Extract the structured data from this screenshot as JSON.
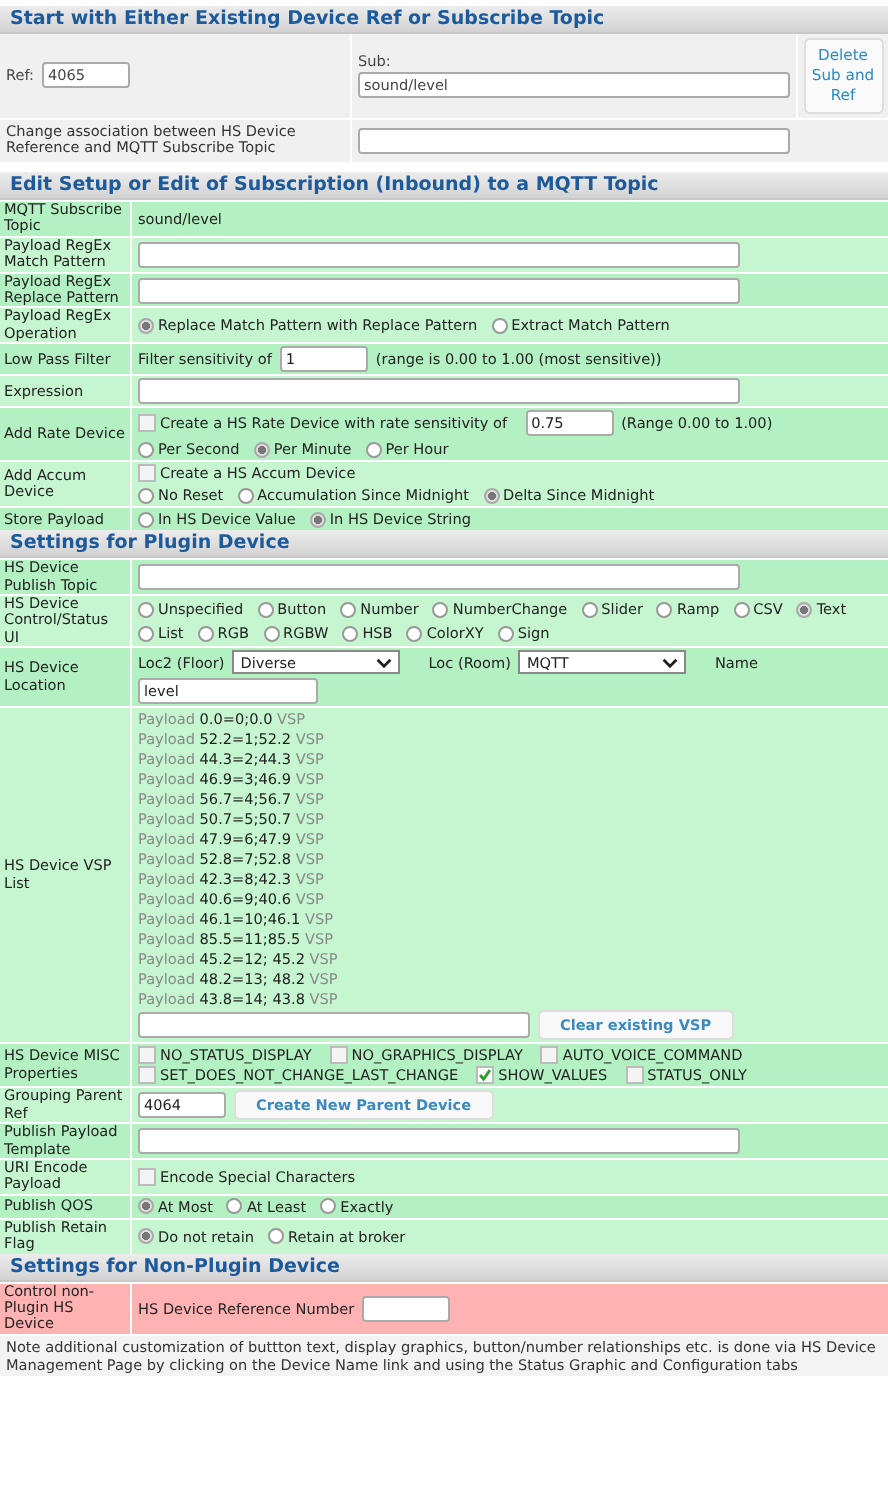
{
  "top": {
    "title": "Start with Either Existing Device Ref or Subscribe Topic",
    "ref_label": "Ref:",
    "ref_value": "4065",
    "sub_label": "Sub:",
    "sub_value": "sound/level",
    "delete_button": "Delete Sub and Ref",
    "change_label": "Change association between HS Device Reference and MQTT Subscribe Topic"
  },
  "sections": [
    {
      "title": "Edit Setup or Edit of Subscription (Inbound) to a MQTT Topic",
      "highlight": false,
      "rows": [
        {
          "label": "MQTT Subscribe Topic",
          "items": [
            {
              "kind": "text",
              "text": "sound/level"
            }
          ]
        },
        {
          "label": "Payload RegEx Match Pattern",
          "items": [
            {
              "kind": "input"
            }
          ]
        },
        {
          "label": "Payload RegEx Replace Pattern",
          "items": [
            {
              "kind": "input"
            }
          ]
        },
        {
          "label": "Payload RegEx Operation",
          "items": [
            {
              "kind": "radio",
              "label": "Replace Match Pattern with Replace Pattern",
              "selected": true
            },
            {
              "kind": "radio",
              "label": "Extract Match Pattern",
              "selected": false
            }
          ]
        },
        {
          "label": "Low Pass Filter",
          "items": [
            {
              "kind": "text",
              "text": "Filter sensitivity of"
            },
            {
              "kind": "number_input",
              "value": "1"
            },
            {
              "kind": "text",
              "text": "(range is 0.00 to 1.00 (most sensitive))"
            }
          ]
        },
        {
          "label": "Expression",
          "items": [
            {
              "kind": "input"
            }
          ]
        },
        {
          "label": "Add Rate Device",
          "items": [
            {
              "kind": "checkbox",
              "label": "Create a HS Rate Device with rate sensitivity of",
              "checked": false
            },
            {
              "kind": "number_input",
              "value": "0.75"
            },
            {
              "kind": "text",
              "text": "(Range 0.00 to 1.00)"
            },
            {
              "kind": "break"
            },
            {
              "kind": "radio",
              "label": "Per Second",
              "selected": false
            },
            {
              "kind": "radio",
              "label": "Per Minute",
              "selected": true
            },
            {
              "kind": "radio",
              "label": "Per Hour",
              "selected": false
            }
          ]
        },
        {
          "label": "Add Accum Device",
          "items": [
            {
              "kind": "checkbox",
              "label": "Create a HS Accum Device",
              "checked": false
            },
            {
              "kind": "break"
            },
            {
              "kind": "radio",
              "label": "No Reset",
              "selected": false
            },
            {
              "kind": "radio",
              "label": "Accumulation Since Midnight",
              "selected": false
            },
            {
              "kind": "radio",
              "label": "Delta Since Midnight",
              "selected": true
            }
          ]
        },
        {
          "label": "Store Payload",
          "items": [
            {
              "kind": "radio",
              "label": "In HS Device Value",
              "selected": false
            },
            {
              "kind": "radio",
              "label": "In HS Device String",
              "selected": true
            }
          ]
        }
      ]
    },
    {
      "title": "Settings for Plugin Device",
      "highlight": false,
      "rows": [
        {
          "label": "HS Device Publish Topic",
          "items": [
            {
              "kind": "input"
            }
          ]
        },
        {
          "label": "HS Device Control/Status UI",
          "items": [
            {
              "kind": "radio",
              "label": "Unspecified",
              "selected": false
            },
            {
              "kind": "radio",
              "label": "Button",
              "selected": false
            },
            {
              "kind": "radio",
              "label": "Number",
              "selected": false
            },
            {
              "kind": "radio",
              "label": "NumberChange",
              "selected": false
            },
            {
              "kind": "radio",
              "label": "Slider",
              "selected": false
            },
            {
              "kind": "radio",
              "label": "Ramp",
              "selected": false
            },
            {
              "kind": "radio",
              "label": "CSV",
              "selected": false
            },
            {
              "kind": "radio",
              "label": "Text",
              "selected": true
            },
            {
              "kind": "radio",
              "label": "List",
              "selected": false
            },
            {
              "kind": "radio",
              "label": "RGB",
              "selected": false
            },
            {
              "kind": "radio",
              "label": "RGBW",
              "selected": false
            },
            {
              "kind": "radio",
              "label": "HSB",
              "selected": false
            },
            {
              "kind": "radio",
              "label": "ColorXY",
              "selected": false
            },
            {
              "kind": "radio",
              "label": "Sign",
              "selected": false
            }
          ]
        },
        {
          "label": "HS Device Location",
          "items": [
            {
              "kind": "text",
              "text": "Loc2 (Floor)"
            },
            {
              "kind": "select",
              "value": "Diverse"
            },
            {
              "kind": "text",
              "text": "Loc (Room)"
            },
            {
              "kind": "select",
              "value": "MQTT"
            },
            {
              "kind": "text",
              "text": "Name"
            },
            {
              "kind": "break"
            },
            {
              "kind": "name_input",
              "value": "level"
            }
          ]
        },
        {
          "label": "HS Device VSP List",
          "items": [
            {
              "kind": "vsp",
              "prefix": "Payload",
              "value": "0.0=0;0.0",
              "suffix": "VSP"
            },
            {
              "kind": "vsp",
              "prefix": "Payload",
              "value": "52.2=1;52.2",
              "suffix": "VSP"
            },
            {
              "kind": "vsp",
              "prefix": "Payload",
              "value": "44.3=2;44.3",
              "suffix": "VSP"
            },
            {
              "kind": "vsp",
              "prefix": "Payload",
              "value": "46.9=3;46.9",
              "suffix": "VSP"
            },
            {
              "kind": "vsp",
              "prefix": "Payload",
              "value": "56.7=4;56.7",
              "suffix": "VSP"
            },
            {
              "kind": "vsp",
              "prefix": "Payload",
              "value": "50.7=5;50.7",
              "suffix": "VSP"
            },
            {
              "kind": "vsp",
              "prefix": "Payload",
              "value": "47.9=6;47.9",
              "suffix": "VSP"
            },
            {
              "kind": "vsp",
              "prefix": "Payload",
              "value": "52.8=7;52.8",
              "suffix": "VSP"
            },
            {
              "kind": "vsp",
              "prefix": "Payload",
              "value": "42.3=8;42.3",
              "suffix": "VSP"
            },
            {
              "kind": "vsp",
              "prefix": "Payload",
              "value": "40.6=9;40.6",
              "suffix": "VSP"
            },
            {
              "kind": "vsp",
              "prefix": "Payload",
              "value": "46.1=10;46.1",
              "suffix": "VSP"
            },
            {
              "kind": "vsp",
              "prefix": "Payload",
              "value": "85.5=11;85.5",
              "suffix": "VSP"
            },
            {
              "kind": "vsp",
              "prefix": "Payload",
              "value": "45.2=12; 45.2",
              "suffix": "VSP"
            },
            {
              "kind": "vsp",
              "prefix": "Payload",
              "value": "48.2=13; 48.2",
              "suffix": "VSP"
            },
            {
              "kind": "vsp",
              "prefix": "Payload",
              "value": "43.8=14; 43.8",
              "suffix": "VSP"
            },
            {
              "kind": "entry_input"
            },
            {
              "kind": "button",
              "label": "Clear existing VSP"
            }
          ]
        },
        {
          "label": "HS Device MISC Properties",
          "items": [
            {
              "kind": "checkbox",
              "label": "NO_STATUS_DISPLAY",
              "checked": false
            },
            {
              "kind": "checkbox",
              "label": "NO_GRAPHICS_DISPLAY",
              "checked": false
            },
            {
              "kind": "checkbox",
              "label": "AUTO_VOICE_COMMAND",
              "checked": false
            },
            {
              "kind": "checkbox",
              "label": "SET_DOES_NOT_CHANGE_LAST_CHANGE",
              "checked": false
            },
            {
              "kind": "checkbox",
              "label": "SHOW_VALUES",
              "checked": true
            },
            {
              "kind": "checkbox",
              "label": "STATUS_ONLY",
              "checked": false
            }
          ]
        },
        {
          "label": "Grouping Parent Ref",
          "items": [
            {
              "kind": "number_input",
              "value": "4064"
            },
            {
              "kind": "button",
              "label": "Create New Parent Device"
            }
          ]
        },
        {
          "label": "Publish Payload Template",
          "items": [
            {
              "kind": "input"
            }
          ]
        },
        {
          "label": "URI Encode Payload",
          "items": [
            {
              "kind": "checkbox",
              "label": "Encode Special Characters",
              "checked": false
            }
          ]
        },
        {
          "label": "Publish QOS",
          "items": [
            {
              "kind": "radio",
              "label": "At Most",
              "selected": true
            },
            {
              "kind": "radio",
              "label": "At Least",
              "selected": false
            },
            {
              "kind": "radio",
              "label": "Exactly",
              "selected": false
            }
          ]
        },
        {
          "label": "Publish Retain Flag",
          "items": [
            {
              "kind": "radio",
              "label": "Do not retain",
              "selected": true
            },
            {
              "kind": "radio",
              "label": "Retain at broker",
              "selected": false
            }
          ]
        }
      ]
    },
    {
      "title": "Settings for Non-Plugin Device",
      "highlight": true,
      "rows": [
        {
          "label": "Control non-Plugin HS Device",
          "items": [
            {
              "kind": "text",
              "text": "HS Device Reference Number"
            },
            {
              "kind": "number_input"
            }
          ]
        }
      ]
    }
  ],
  "note": "Note additional customization of buttton text, display graphics, button/number relationships etc. is done via HS Device Management Page by clicking on the Device Name link and using the Status Graphic and Configuration tabs"
}
